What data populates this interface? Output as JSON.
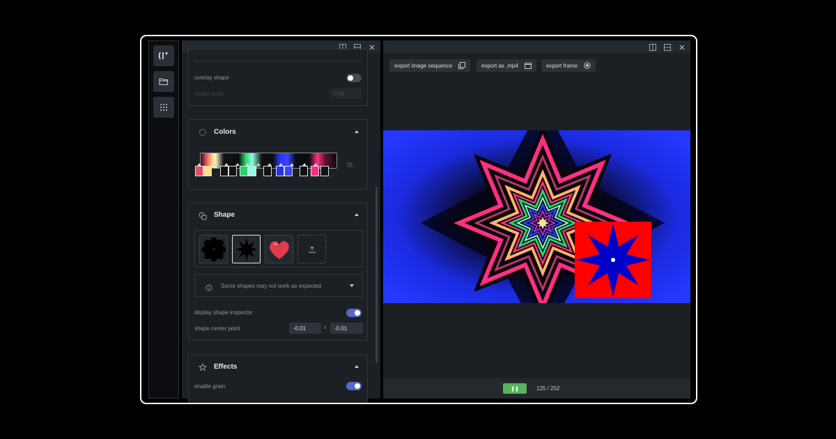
{
  "left_panel": {
    "overlay_shape_label": "overlay shape",
    "overlay_shape_on": false,
    "shape_scale_label": "shape scale",
    "shape_scale_value": "0.36",
    "colors": {
      "title": "Colors",
      "swatches": [
        "#e84a5f",
        "#ffe08a",
        "#101214",
        "#101214",
        "#26d36e",
        "#8fffe0",
        "#101214",
        "#2433ee",
        "#3a46ff",
        "#101214",
        "#ff2f86",
        "#101214"
      ]
    },
    "shape": {
      "title": "Shape",
      "shapes": [
        "flower-shape-icon",
        "star-shape-icon",
        "heart-shape-icon",
        "upload-icon"
      ],
      "warning": "Some shapes may not work as expected",
      "display_inspector_label": "display shape inspector",
      "display_inspector_on": true,
      "center_label": "shape center point",
      "center_x": "-0.01",
      "center_sep": "x",
      "center_y": "-0.01"
    },
    "effects": {
      "title": "Effects",
      "grain_label": "enable grain",
      "grain_on": true
    }
  },
  "right_panel": {
    "buttons": [
      "export image sequence",
      "export as .mp4",
      "export frame"
    ],
    "play_pause_label": "❚❚",
    "frame_counter": "125 / 252"
  },
  "colors": {
    "accent_toggle": "#5866c9",
    "play_button": "#58b25e",
    "panel_bg": "#1c2024"
  }
}
